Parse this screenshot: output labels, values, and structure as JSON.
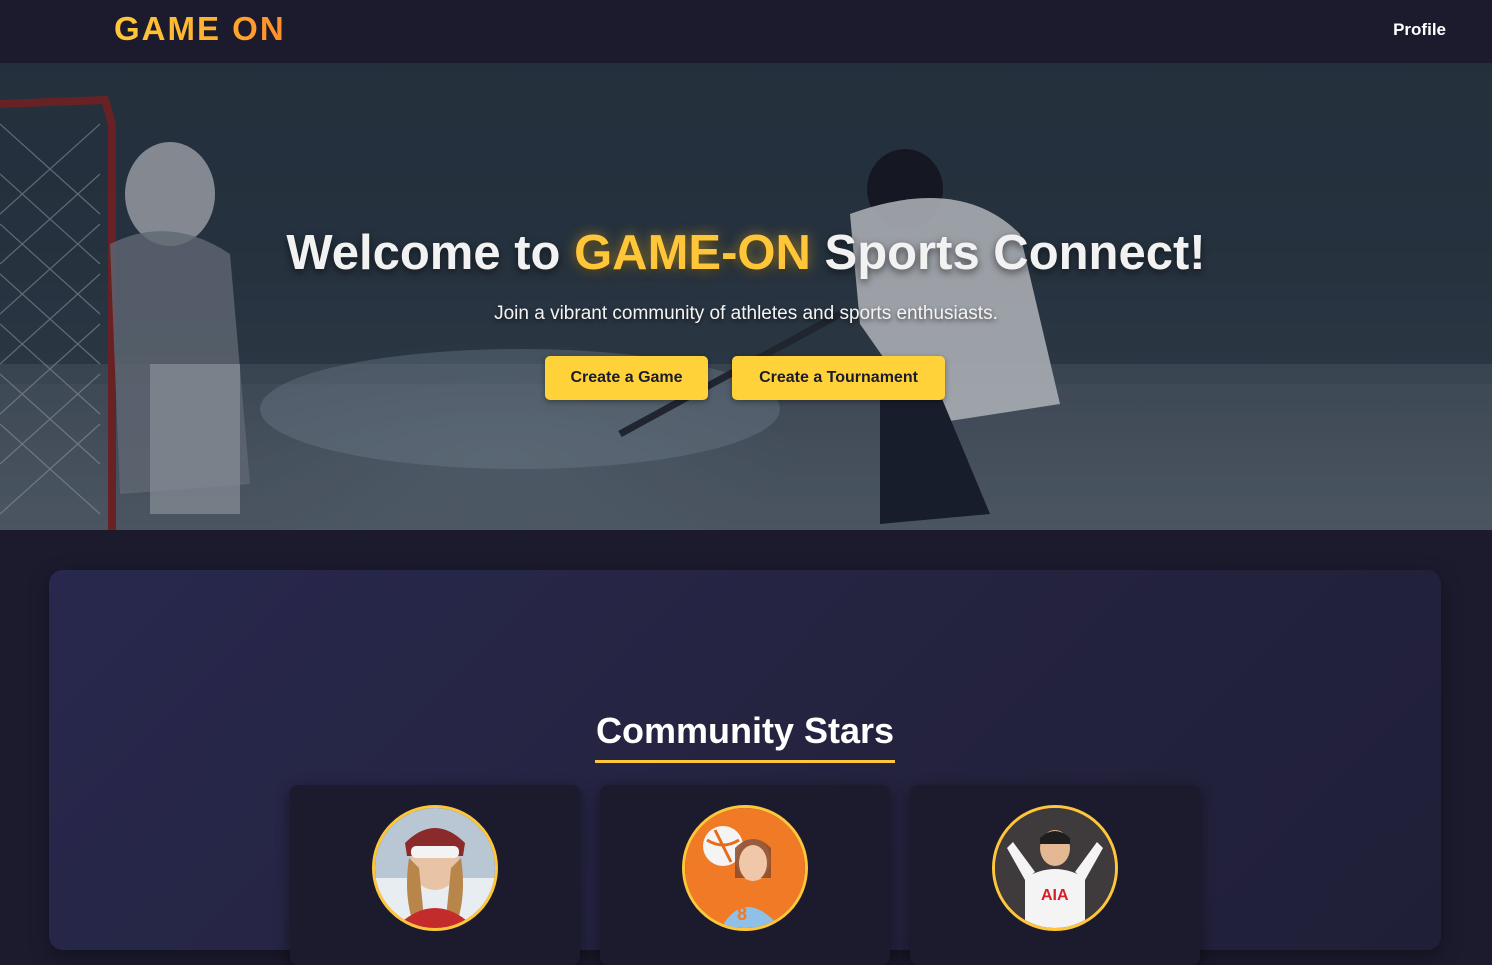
{
  "navbar": {
    "brand": "GAME ON",
    "profile_link": "Profile"
  },
  "hero": {
    "title_prefix": "Welcome to",
    "title_accent": "GAME-ON",
    "title_suffix": "Sports Connect!",
    "subtitle": "Join a vibrant community of athletes and sports enthusiasts.",
    "buttons": {
      "create_game": "Create a Game",
      "create_tournament": "Create a Tournament"
    }
  },
  "community": {
    "title": "Community Stars",
    "stars": [
      {
        "avatar": "skier-avatar"
      },
      {
        "avatar": "volleyball-player-avatar"
      },
      {
        "avatar": "soccer-player-avatar"
      }
    ]
  },
  "colors": {
    "background": "#1c1b2e",
    "accent": "#ffc63a",
    "button": "#ffd23a",
    "section": "#25244a"
  }
}
